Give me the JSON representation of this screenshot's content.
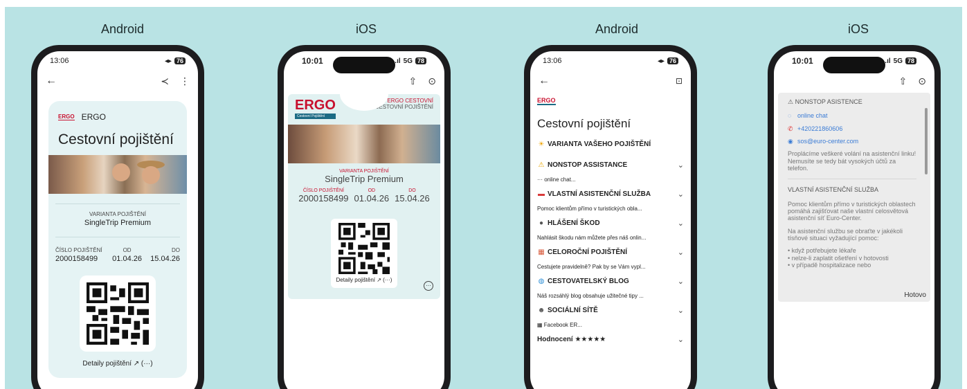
{
  "labels": [
    "Android",
    "iOS",
    "Android",
    "iOS"
  ],
  "phone1": {
    "time": "13:06",
    "battery": "76",
    "brand": "ERGO",
    "title": "Cestovní pojištění",
    "variant_label": "VARIANTA POJIŠTĚNÍ",
    "variant_value": "SingleTrip Premium",
    "policy_label": "ČÍSLO POJIŠTĚNÍ",
    "policy_value": "2000158499",
    "from_label": "OD",
    "from_value": "01.04.26",
    "to_label": "DO",
    "to_value": "15.04.26",
    "details_link": "Detaily pojištění ↗ (···)"
  },
  "phone2": {
    "time": "10:01",
    "network": "5G",
    "battery": "78",
    "brand": "ERGO",
    "brand_sub": "Cestovní Pojištění",
    "header_line1": "ERGO CESTOVNÍ",
    "header_line2": "CESTOVNÍ POJIŠTĚNÍ",
    "variant_label": "VARIANTA POJIŠTĚNÍ",
    "variant_value": "SingleTrip Premium",
    "policy_label": "ČÍSLO POJIŠTĚNÍ",
    "policy_value": "2000158499",
    "from_label": "OD",
    "from_value": "01.04.26",
    "to_label": "DO",
    "to_value": "15.04.26",
    "details_link": "Detaily pojištění ↗ (···)"
  },
  "phone3": {
    "time": "13:06",
    "battery": "76",
    "brand": "ERGO",
    "title": "Cestovní pojištění",
    "sections": [
      {
        "icon": "☀",
        "title": "VARIANTA VAŠEHO POJIŠTĚNÍ",
        "body": "",
        "chevron": ""
      },
      {
        "icon": "⚠",
        "title": "NONSTOP ASSISTANCE",
        "body": "··· online chat...",
        "chevron": "⌄"
      },
      {
        "icon": "▬",
        "title": "VLASTNÍ ASISTENČNÍ SLUŽBA",
        "body": "Pomoc klientům přímo v turistických obla...",
        "chevron": "⌄"
      },
      {
        "icon": "●",
        "title": "HLÁŠENÍ ŠKOD",
        "body": "Nahlásit škodu nám můžete přes náš onlin...",
        "chevron": "⌄"
      },
      {
        "icon": "▦",
        "title": "CELOROČNÍ POJIŠTĚNÍ",
        "body": "Cestujete pravidelně? Pak by se Vám vypl...",
        "chevron": "⌄"
      },
      {
        "icon": "◍",
        "title": "CESTOVATELSKÝ BLOG",
        "body": "Náš rozsáhlý blog obsahuje užitečné tipy ...",
        "chevron": "⌄"
      },
      {
        "icon": "☻",
        "title": "SOCIÁLNÍ SÍTĚ",
        "body": "▦ Facebook ER...",
        "chevron": "⌄"
      },
      {
        "icon": "",
        "title": "Hodnocení ★★★★★",
        "body": "",
        "chevron": "⌄"
      }
    ]
  },
  "phone4": {
    "time": "10:01",
    "network": "5G",
    "battery": "78",
    "heading1": "⚠ NONSTOP ASISTENCE",
    "link_chat": "online chat",
    "link_phone": "+420221860606",
    "link_email": "sos@euro-center.com",
    "para1": "Proplácíme veškeré volání na asistenční linku! Nemusíte se tedy bát vysokých účtů za telefon.",
    "heading2": "VLASTNÍ ASISTENČNÍ SLUŽBA",
    "para2": "Pomoc klientům přímo v turistických oblastech pomáhá zajišťovat naše vlastní celosvětová asistenční síť Euro-Center.",
    "para3": "Na asistenční službu se obraťte v jakékoli tísňové situaci vyžadující pomoc:",
    "bullet1": "• když potřebujete lékaře",
    "bullet2": "• nelze-li zaplatit ošetření v hotovosti",
    "bullet3": "• v případě hospitalizace nebo",
    "done": "Hotovo"
  }
}
